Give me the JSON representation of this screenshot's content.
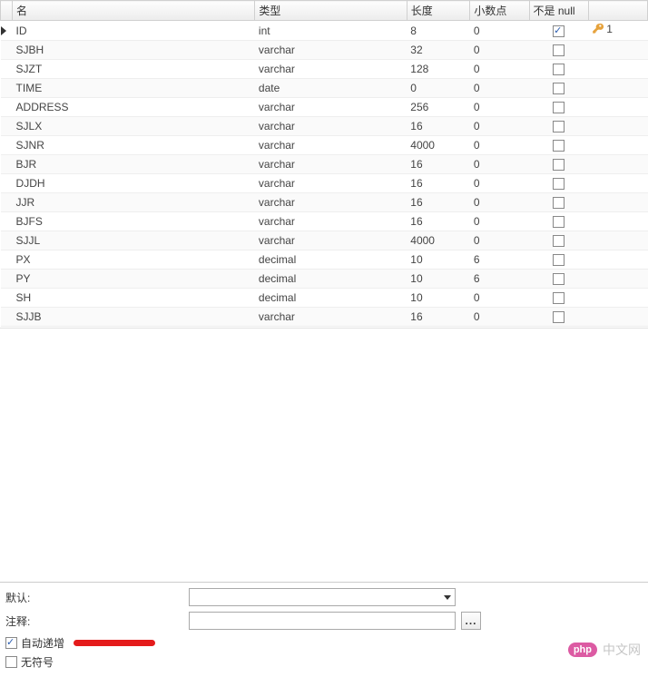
{
  "headers": {
    "name": "名",
    "type": "类型",
    "length": "长度",
    "decimals": "小数点",
    "notnull": "不是 null"
  },
  "rows": [
    {
      "name": "ID",
      "type": "int",
      "length": "8",
      "decimals": "0",
      "notnull": true,
      "key": "1",
      "current": true
    },
    {
      "name": "SJBH",
      "type": "varchar",
      "length": "32",
      "decimals": "0",
      "notnull": false
    },
    {
      "name": "SJZT",
      "type": "varchar",
      "length": "128",
      "decimals": "0",
      "notnull": false
    },
    {
      "name": "TIME",
      "type": "date",
      "length": "0",
      "decimals": "0",
      "notnull": false
    },
    {
      "name": "ADDRESS",
      "type": "varchar",
      "length": "256",
      "decimals": "0",
      "notnull": false
    },
    {
      "name": "SJLX",
      "type": "varchar",
      "length": "16",
      "decimals": "0",
      "notnull": false
    },
    {
      "name": "SJNR",
      "type": "varchar",
      "length": "4000",
      "decimals": "0",
      "notnull": false
    },
    {
      "name": "BJR",
      "type": "varchar",
      "length": "16",
      "decimals": "0",
      "notnull": false
    },
    {
      "name": "DJDH",
      "type": "varchar",
      "length": "16",
      "decimals": "0",
      "notnull": false
    },
    {
      "name": "JJR",
      "type": "varchar",
      "length": "16",
      "decimals": "0",
      "notnull": false
    },
    {
      "name": "BJFS",
      "type": "varchar",
      "length": "16",
      "decimals": "0",
      "notnull": false
    },
    {
      "name": "SJJL",
      "type": "varchar",
      "length": "4000",
      "decimals": "0",
      "notnull": false
    },
    {
      "name": "PX",
      "type": "decimal",
      "length": "10",
      "decimals": "6",
      "notnull": false
    },
    {
      "name": "PY",
      "type": "decimal",
      "length": "10",
      "decimals": "6",
      "notnull": false
    },
    {
      "name": "SH",
      "type": "decimal",
      "length": "10",
      "decimals": "0",
      "notnull": false
    },
    {
      "name": "SJJB",
      "type": "varchar",
      "length": "16",
      "decimals": "0",
      "notnull": false
    }
  ],
  "bottom": {
    "default_label": "默认:",
    "comment_label": "注释:",
    "auto_increment_label": "自动递增",
    "unsigned_label": "无符号",
    "auto_increment_checked": true,
    "unsigned_checked": false,
    "ellipsis": "..."
  },
  "watermark": {
    "badge": "php",
    "text": "中文网"
  }
}
